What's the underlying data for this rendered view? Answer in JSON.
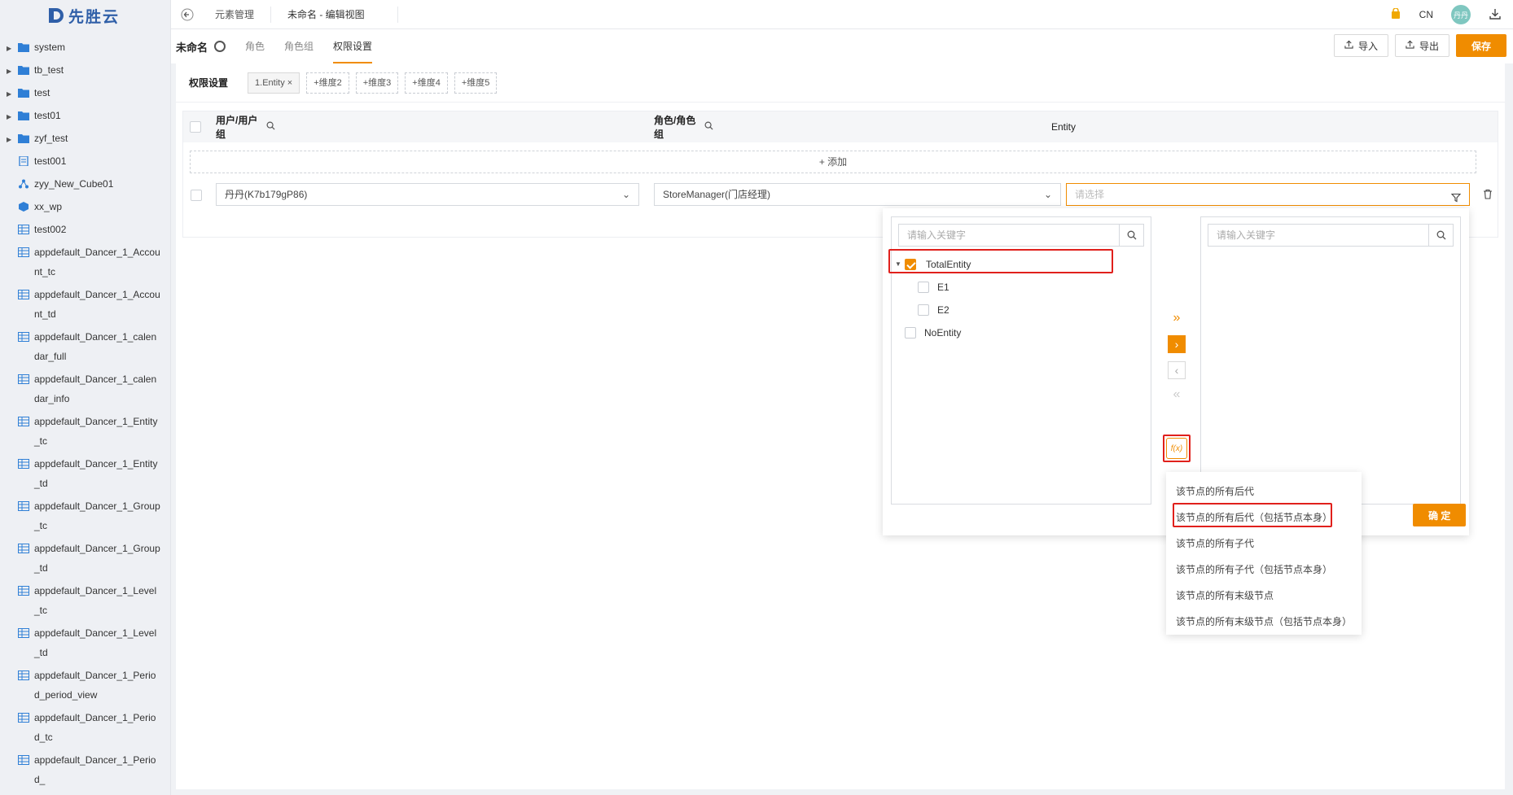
{
  "brand": {
    "name": "先胜云"
  },
  "sidebar": {
    "items": [
      {
        "label": "system",
        "type": "folder",
        "expandable": true
      },
      {
        "label": "tb_test",
        "type": "folder",
        "expandable": true
      },
      {
        "label": "test",
        "type": "folder",
        "expandable": true
      },
      {
        "label": "test01",
        "type": "folder",
        "expandable": true
      },
      {
        "label": "zyf_test",
        "type": "folder",
        "expandable": true
      },
      {
        "label": "test001",
        "type": "doc"
      },
      {
        "label": "zyy_New_Cube01",
        "type": "cube"
      },
      {
        "label": "xx_wp",
        "type": "box"
      },
      {
        "label": "test002",
        "type": "table"
      },
      {
        "label": "appdefault_Dancer_1_Account_tc",
        "type": "table"
      },
      {
        "label": "appdefault_Dancer_1_Account_td",
        "type": "table"
      },
      {
        "label": "appdefault_Dancer_1_calendar_full",
        "type": "table"
      },
      {
        "label": "appdefault_Dancer_1_calendar_info",
        "type": "table"
      },
      {
        "label": "appdefault_Dancer_1_Entity_tc",
        "type": "table"
      },
      {
        "label": "appdefault_Dancer_1_Entity_td",
        "type": "table"
      },
      {
        "label": "appdefault_Dancer_1_Group_tc",
        "type": "table"
      },
      {
        "label": "appdefault_Dancer_1_Group_td",
        "type": "table"
      },
      {
        "label": "appdefault_Dancer_1_Level_tc",
        "type": "table"
      },
      {
        "label": "appdefault_Dancer_1_Level_td",
        "type": "table"
      },
      {
        "label": "appdefault_Dancer_1_Period_period_view",
        "type": "table"
      },
      {
        "label": "appdefault_Dancer_1_Period_tc",
        "type": "table"
      },
      {
        "label": "appdefault_Dancer_1_Period_",
        "type": "table"
      }
    ]
  },
  "topbar": {
    "tabs": [
      "元素管理",
      "未命名 - 编辑视图"
    ],
    "lang": "CN",
    "avatar": "丹丹"
  },
  "subhead": {
    "view_name": "未命名",
    "tabs": [
      "角色",
      "角色组",
      "权限设置"
    ],
    "import": "导入",
    "export": "导出",
    "save": "保存"
  },
  "dims": {
    "title": "权限设置",
    "chips": [
      "1.Entity ×",
      "+维度2",
      "+维度3",
      "+维度4",
      "+维度5"
    ]
  },
  "table": {
    "headers": [
      "用户/用户组",
      "角色/角色组",
      "Entity"
    ],
    "add": "+ 添加",
    "row": {
      "user": "丹丹(K7b179gP86)",
      "role": "StoreManager(门店经理)",
      "entity_placeholder": "请选择"
    }
  },
  "popup": {
    "left_search": "请输入关键字",
    "right_search": "请输入关键字",
    "nodes": [
      "TotalEntity",
      "E1",
      "E2",
      "NoEntity"
    ],
    "confirm": "确 定",
    "fx": "f(x)"
  },
  "menu": {
    "items": [
      "该节点的所有后代",
      "该节点的所有后代（包括节点本身）",
      "该节点的所有子代",
      "该节点的所有子代（包括节点本身）",
      "该节点的所有末级节点",
      "该节点的所有末级节点（包括节点本身）"
    ]
  },
  "colors": {
    "accent": "#f08c00",
    "highlight": "#e0201c",
    "brand": "#2f5fa8"
  }
}
